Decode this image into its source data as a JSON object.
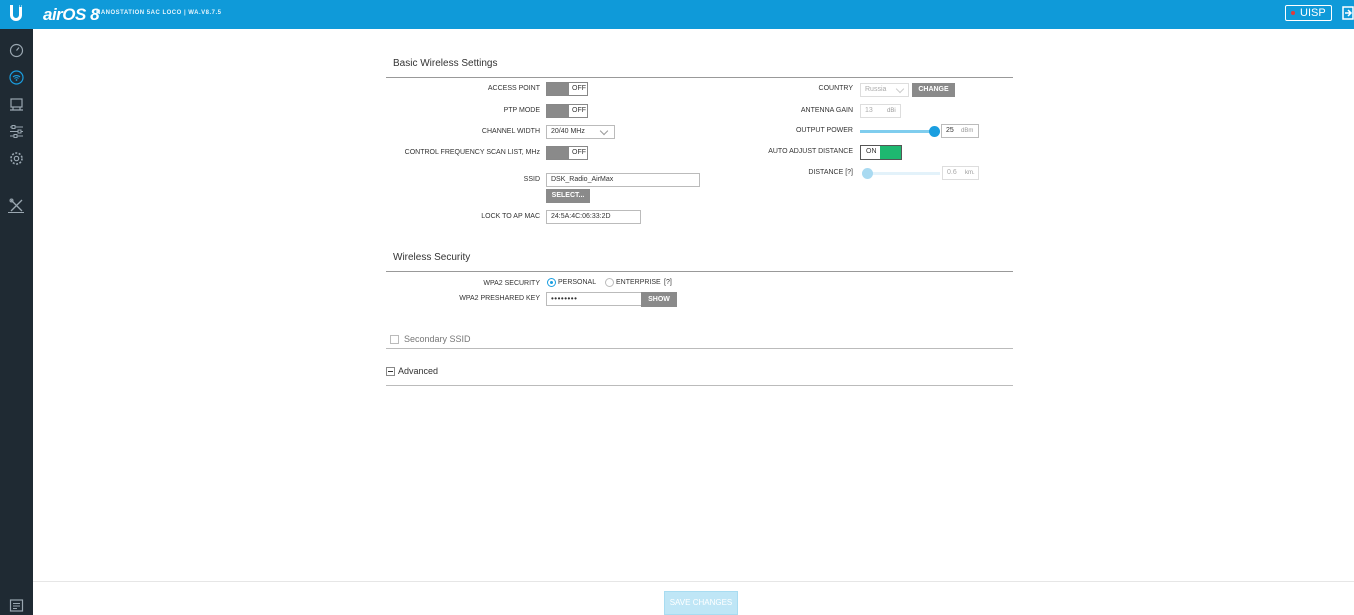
{
  "header": {
    "brand": "airOS 8",
    "device": "NANOSTATION 5AC LOCO | WA.V8.7.5",
    "uisp_label": "UISP",
    "colors": {
      "topbar": "#0f9ad9",
      "sidebar": "#1f2a33",
      "accent": "#1a9ee0",
      "on": "#1eb870"
    }
  },
  "sidebar": {
    "items": [
      {
        "icon": "dashboard-icon"
      },
      {
        "icon": "wireless-icon"
      },
      {
        "icon": "network-icon"
      },
      {
        "icon": "services-icon"
      },
      {
        "icon": "system-icon"
      },
      {
        "icon": "tools-icon"
      }
    ],
    "bottom_icon": "log-icon"
  },
  "basic": {
    "title": "Basic Wireless Settings",
    "access_point": {
      "label": "ACCESS POINT",
      "state": "OFF"
    },
    "ptp_mode": {
      "label": "PTP MODE",
      "state": "OFF"
    },
    "channel_width": {
      "label": "CHANNEL WIDTH",
      "value": "20/40 MHz"
    },
    "freq_scan": {
      "label": "CONTROL FREQUENCY SCAN LIST, MHz",
      "state": "OFF"
    },
    "ssid": {
      "label": "SSID",
      "value": "DSK_Radio_AirMax",
      "select_label": "SELECT..."
    },
    "lock_mac": {
      "label": "LOCK TO AP MAC",
      "value": "24:5A:4C:06:33:2D"
    },
    "country": {
      "label": "COUNTRY",
      "value": "Russia",
      "change_label": "CHANGE"
    },
    "antenna_gain": {
      "label": "ANTENNA GAIN",
      "value": "13",
      "unit": "dBi"
    },
    "output_power": {
      "label": "OUTPUT POWER",
      "value": "25",
      "unit": "dBm",
      "level": 1.0
    },
    "auto_distance": {
      "label": "AUTO ADJUST DISTANCE",
      "state": "ON"
    },
    "distance": {
      "label": "DISTANCE [?]",
      "value": "0.6",
      "unit": "km.",
      "level": 0.0
    }
  },
  "security": {
    "title": "Wireless Security",
    "wpa2_label": "WPA2 SECURITY",
    "personal": "PERSONAL",
    "enterprise": "ENTERPRISE",
    "help": "[?]",
    "key_label": "WPA2 PRESHARED KEY",
    "key_value": "••••••••",
    "show_label": "SHOW"
  },
  "secondary": {
    "label": "Secondary SSID"
  },
  "advanced": {
    "label": "Advanced"
  },
  "footer": {
    "save_label": "SAVE CHANGES"
  }
}
